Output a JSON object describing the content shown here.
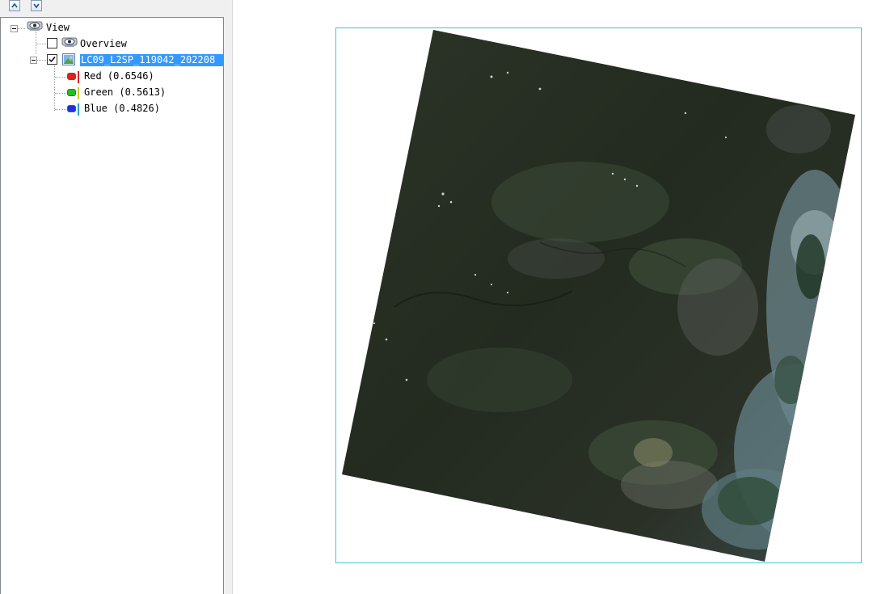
{
  "toolbar": {
    "up_icon": "chevron-up-icon",
    "down_icon": "chevron-down-icon"
  },
  "tree": {
    "root": {
      "label": "View",
      "icon": "eye-view-icon",
      "expanded": true
    },
    "overview": {
      "label": "Overview",
      "checked": false,
      "icon": "eye-view-icon"
    },
    "layer": {
      "label": "LC09_L2SP_119042_202208",
      "checked": true,
      "selected": true,
      "icon": "raster-image-icon",
      "expanded": true
    },
    "bands": [
      {
        "label": "Red (0.6546)",
        "color": "#e02020"
      },
      {
        "label": "Green (0.5613)",
        "color": "#20c020"
      },
      {
        "label": "Blue (0.4826)",
        "color": "#2030e0"
      }
    ]
  },
  "colors": {
    "selection": "#3399ff",
    "frame_border": "#3ec7d3",
    "band_bar_red": "#e02020",
    "band_bar_green": "#c8d000",
    "band_bar_blue": "#20a0e0"
  }
}
